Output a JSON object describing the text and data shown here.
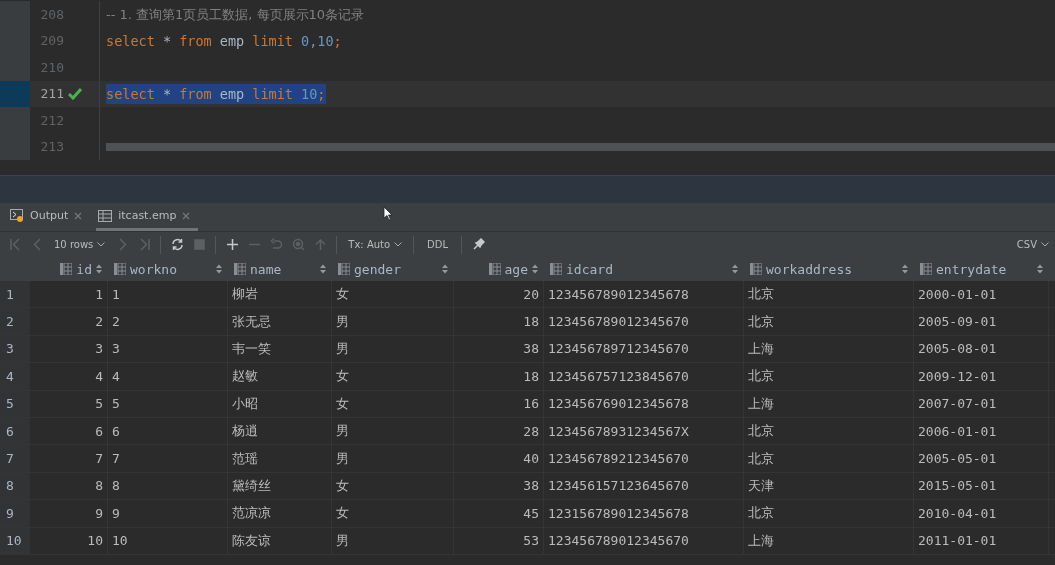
{
  "editor": {
    "lines": [
      {
        "number": "208",
        "executed": false,
        "selected": false,
        "tokens": [
          {
            "kind": "comment",
            "text": "-- 1. 查询第1页员工数据, 每页展示10条记录"
          }
        ]
      },
      {
        "number": "209",
        "executed": false,
        "selected": false,
        "tokens": [
          {
            "kind": "keyword",
            "text": "select"
          },
          {
            "kind": "plain",
            "text": " * "
          },
          {
            "kind": "keyword",
            "text": "from"
          },
          {
            "kind": "plain",
            "text": " emp "
          },
          {
            "kind": "keyword",
            "text": "limit"
          },
          {
            "kind": "number",
            "text": " 0,10"
          },
          {
            "kind": "keyword",
            "text": ";"
          }
        ]
      },
      {
        "number": "210",
        "executed": false,
        "selected": false
      },
      {
        "number": "211",
        "executed": true,
        "selected": true,
        "tokens": [
          {
            "kind": "keyword",
            "text": "select"
          },
          {
            "kind": "plain",
            "text": " * "
          },
          {
            "kind": "keyword",
            "text": "from"
          },
          {
            "kind": "plain",
            "text": " emp "
          },
          {
            "kind": "keyword",
            "text": "limit"
          },
          {
            "kind": "number",
            "text": " 10"
          },
          {
            "kind": "keyword",
            "text": ";"
          }
        ]
      },
      {
        "number": "212",
        "executed": false,
        "selected": false
      },
      {
        "number": "213",
        "executed": false,
        "selected": false
      }
    ]
  },
  "tabs": [
    {
      "label": "Output",
      "selected": false
    },
    {
      "label": "itcast.emp",
      "selected": true
    }
  ],
  "toolbar": [
    {
      "kind": "first",
      "disabled": true
    },
    {
      "kind": "prev",
      "disabled": true
    },
    {
      "kind": "dropdown",
      "label": "10 rows"
    },
    {
      "kind": "next",
      "disabled": true
    },
    {
      "kind": "last",
      "disabled": true
    },
    {
      "kind": "sep"
    },
    {
      "kind": "refresh",
      "disabled": false
    },
    {
      "kind": "stop",
      "disabled": true
    },
    {
      "kind": "sep"
    },
    {
      "kind": "add",
      "disabled": false
    },
    {
      "kind": "remove",
      "disabled": true
    },
    {
      "kind": "revert",
      "disabled": true
    },
    {
      "kind": "preview",
      "disabled": true
    },
    {
      "kind": "submit",
      "disabled": true
    },
    {
      "kind": "sep"
    },
    {
      "kind": "dropdown",
      "label": "Tx: Auto"
    },
    {
      "kind": "sep"
    },
    {
      "kind": "text",
      "label": "DDL"
    },
    {
      "kind": "sep"
    },
    {
      "kind": "pin",
      "disabled": false
    }
  ],
  "export_menu": {
    "label": "CSV"
  },
  "table": {
    "columns": [
      {
        "name": "id"
      },
      {
        "name": "workno"
      },
      {
        "name": "name"
      },
      {
        "name": "gender"
      },
      {
        "name": "age"
      },
      {
        "name": "idcard"
      },
      {
        "name": "workaddress"
      },
      {
        "name": "entrydate"
      }
    ],
    "rows": [
      {
        "number": "1",
        "cells": [
          "1",
          "1",
          "柳岩",
          "女",
          "20",
          "123456789012345678",
          "北京",
          "2000-01-01"
        ]
      },
      {
        "number": "2",
        "cells": [
          "2",
          "2",
          "张无忌",
          "男",
          "18",
          "123456789012345670",
          "北京",
          "2005-09-01"
        ]
      },
      {
        "number": "3",
        "cells": [
          "3",
          "3",
          "韦一笑",
          "男",
          "38",
          "123456789712345670",
          "上海",
          "2005-08-01"
        ]
      },
      {
        "number": "4",
        "cells": [
          "4",
          "4",
          "赵敏",
          "女",
          "18",
          "123456757123845670",
          "北京",
          "2009-12-01"
        ]
      },
      {
        "number": "5",
        "cells": [
          "5",
          "5",
          "小昭",
          "女",
          "16",
          "123456769012345678",
          "上海",
          "2007-07-01"
        ]
      },
      {
        "number": "6",
        "cells": [
          "6",
          "6",
          "杨逍",
          "男",
          "28",
          "12345678931234567X",
          "北京",
          "2006-01-01"
        ]
      },
      {
        "number": "7",
        "cells": [
          "7",
          "7",
          "范瑶",
          "男",
          "40",
          "123456789212345670",
          "北京",
          "2005-05-01"
        ]
      },
      {
        "number": "8",
        "cells": [
          "8",
          "8",
          "黛绮丝",
          "女",
          "38",
          "123456157123645670",
          "天津",
          "2015-05-01"
        ]
      },
      {
        "number": "9",
        "cells": [
          "9",
          "9",
          "范凉凉",
          "女",
          "45",
          "123156789012345678",
          "北京",
          "2010-04-01"
        ]
      },
      {
        "number": "10",
        "cells": [
          "10",
          "10",
          "陈友谅",
          "男",
          "53",
          "123456789012345670",
          "上海",
          "2011-01-01"
        ]
      }
    ]
  }
}
